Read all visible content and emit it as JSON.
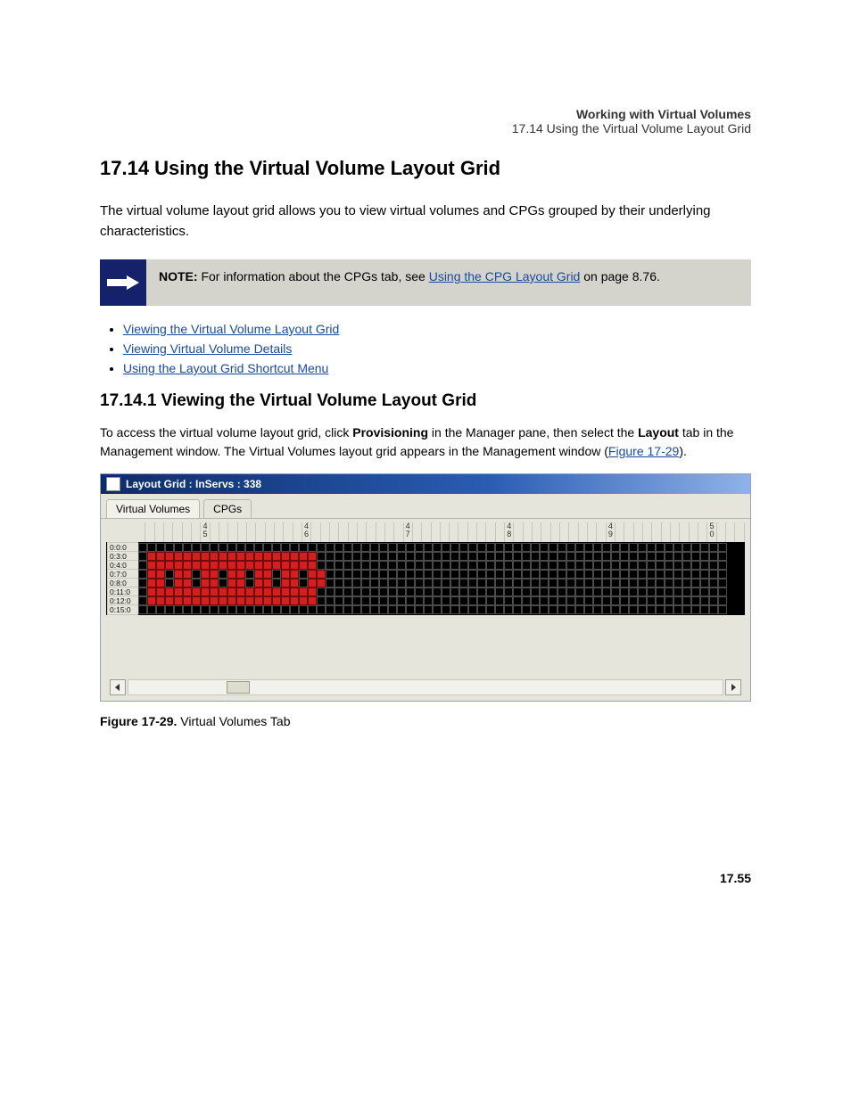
{
  "header": {
    "line1": "Working with Virtual Volumes",
    "line2": "17.14 Using the Virtual Volume Layout Grid"
  },
  "chapter": "17.14 Using the Virtual Volume Layout Grid",
  "intro": "The virtual volume layout grid allows you to view virtual volumes and CPGs grouped by their underlying characteristics.",
  "note": {
    "label": "NOTE:",
    "text_before": "For information about the CPGs tab, see ",
    "link_text": "Using the CPG Layout Grid",
    "text_after": " on ",
    "page_ref": "page 8.76."
  },
  "links": [
    "Viewing the Virtual Volume Layout Grid",
    "Viewing Virtual Volume Details",
    "Using the Layout Grid Shortcut Menu"
  ],
  "subhead": "17.14.1 Viewing the Virtual Volume Layout Grid",
  "paragraphs": {
    "p1_a": "To access the virtual volume layout grid, click ",
    "p1_b": "Provisioning",
    "p1_c": " in the Manager pane, then select the ",
    "p1_d": "Layout",
    "p1_e": " tab in the Management window. The Virtual Volumes layout grid appears in the Management window (",
    "p1_f": ")."
  },
  "figure_ref": "Figure 17-29",
  "window": {
    "title": "Layout Grid : InServs : 338",
    "tabs": [
      "Virtual Volumes",
      "CPGs"
    ],
    "ruler_labels": [
      "45",
      "46",
      "47",
      "48",
      "49",
      "50"
    ],
    "row_labels": [
      "0:0:0",
      "0:3:0",
      "0:4:0",
      "0:7:0",
      "0:8:0",
      "0:11:0",
      "0:12:0",
      "0:15:0"
    ],
    "cols": 66,
    "pattern_rows": [
      {
        "ranges": []
      },
      {
        "ranges": [
          [
            1,
            19
          ]
        ]
      },
      {
        "ranges": [
          [
            1,
            19
          ]
        ]
      },
      {
        "ranges": [
          [
            1,
            2
          ],
          [
            4,
            5
          ],
          [
            7,
            8
          ],
          [
            10,
            11
          ],
          [
            13,
            14
          ],
          [
            16,
            17
          ],
          [
            19,
            20
          ]
        ]
      },
      {
        "ranges": [
          [
            1,
            2
          ],
          [
            4,
            5
          ],
          [
            7,
            8
          ],
          [
            10,
            11
          ],
          [
            13,
            14
          ],
          [
            16,
            17
          ],
          [
            19,
            20
          ]
        ]
      },
      {
        "ranges": [
          [
            1,
            19
          ]
        ]
      },
      {
        "ranges": [
          [
            1,
            19
          ]
        ]
      },
      {
        "ranges": []
      }
    ]
  },
  "caption": {
    "label": "Figure 17-29.",
    "text": "Virtual Volumes Tab"
  },
  "page_number": "17.55"
}
